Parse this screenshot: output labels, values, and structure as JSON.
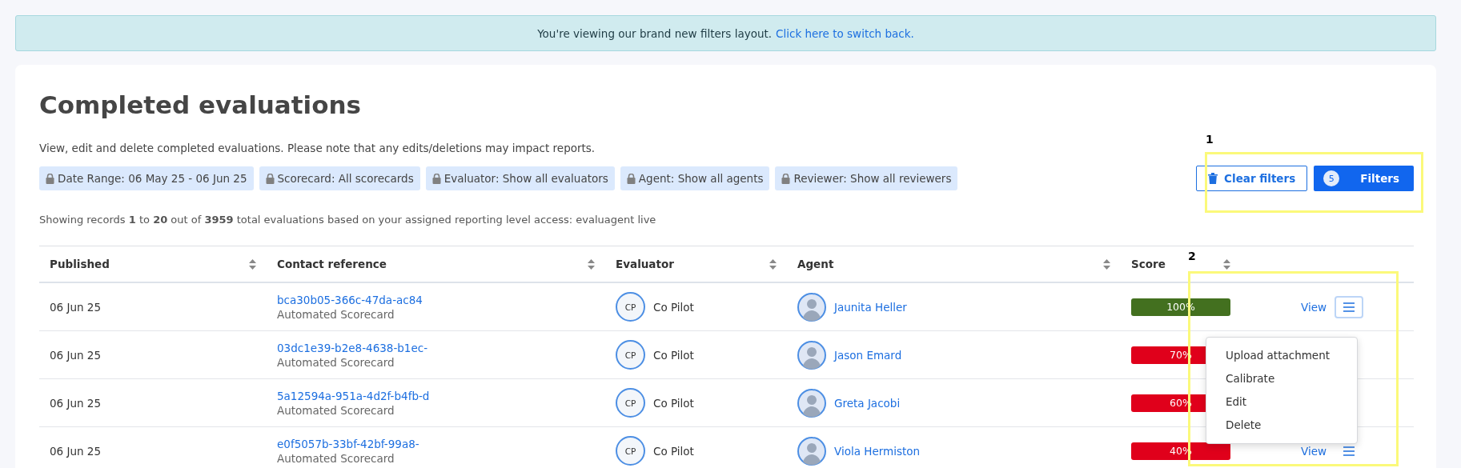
{
  "banner": {
    "text": "You're viewing our brand new filters layout.",
    "link": "Click here to switch back."
  },
  "page": {
    "title": "Completed evaluations",
    "description": "View, edit and delete completed evaluations. Please note that any edits/deletions may impact reports."
  },
  "filter_chips": [
    {
      "label": "Date Range: 06 May 25 - 06 Jun 25"
    },
    {
      "label": "Scorecard: All scorecards"
    },
    {
      "label": "Evaluator: Show all evaluators"
    },
    {
      "label": "Agent: Show all agents"
    },
    {
      "label": "Reviewer: Show all reviewers"
    }
  ],
  "filter_actions": {
    "clear_label": "Clear filters",
    "filters_label": "Filters",
    "filters_count": "5"
  },
  "summary": "Showing records **1** to **20** out of **3959** total evaluations based on your assigned reporting level access: evaluagent live",
  "table": {
    "columns": [
      {
        "label": "Published"
      },
      {
        "label": "Contact reference"
      },
      {
        "label": "Evaluator"
      },
      {
        "label": "Agent"
      },
      {
        "label": "Score"
      }
    ],
    "rows": [
      {
        "published": "06 Jun 25",
        "reference": "bca30b05-366c-47da-ac84",
        "scorecard": "Automated Scorecard",
        "evaluator_initials": "CP",
        "evaluator": "Co Pilot",
        "agent": "Jaunita Heller",
        "score": "100%",
        "color": "#43701f",
        "view": "View",
        "menu_open": true
      },
      {
        "published": "06 Jun 25",
        "reference": "03dc1e39-b2e8-4638-b1ec-",
        "scorecard": "Automated Scorecard",
        "evaluator_initials": "CP",
        "evaluator": "Co Pilot",
        "agent": "Jason Emard",
        "score": "70%",
        "color": "#e0001b"
      },
      {
        "published": "06 Jun 25",
        "reference": "5a12594a-951a-4d2f-b4fb-d",
        "scorecard": "Automated Scorecard",
        "evaluator_initials": "CP",
        "evaluator": "Co Pilot",
        "agent": "Greta Jacobi",
        "score": "60%",
        "color": "#e0001b"
      },
      {
        "published": "06 Jun 25",
        "reference": "e0f5057b-33bf-42bf-99a8-",
        "scorecard": "Automated Scorecard",
        "evaluator_initials": "CP",
        "evaluator": "Co Pilot",
        "agent": "Viola Hermiston",
        "score": "40%",
        "color": "#e0001b",
        "view": "View",
        "menu_open": false
      }
    ]
  },
  "row_menu": {
    "items": [
      {
        "label": "Upload attachment"
      },
      {
        "label": "Calibrate"
      },
      {
        "label": "Edit"
      },
      {
        "label": "Delete"
      }
    ]
  },
  "annotations": [
    {
      "label": "1"
    },
    {
      "label": "2"
    }
  ]
}
